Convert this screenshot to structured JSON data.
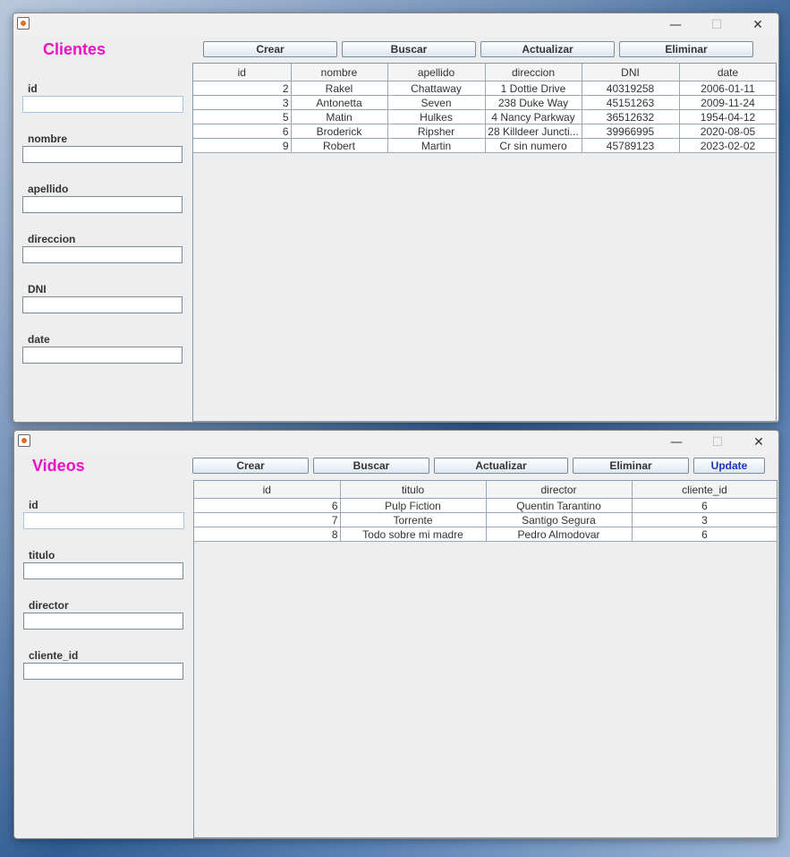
{
  "clientes": {
    "title": "Clientes",
    "window_controls": {
      "minimize": "—",
      "maximize": "☐",
      "close": "✕"
    },
    "buttons": {
      "crear": "Crear",
      "buscar": "Buscar",
      "actualizar": "Actualizar",
      "eliminar": "Eliminar"
    },
    "fields": {
      "id": {
        "label": "id",
        "value": ""
      },
      "nombre": {
        "label": "nombre",
        "value": ""
      },
      "apellido": {
        "label": "apellido",
        "value": ""
      },
      "direccion": {
        "label": "direccion",
        "value": ""
      },
      "dni": {
        "label": "DNI",
        "value": ""
      },
      "date": {
        "label": "date",
        "value": ""
      }
    },
    "table": {
      "columns": [
        "id",
        "nombre",
        "apellido",
        "direccion",
        "DNI",
        "date"
      ],
      "rows": [
        [
          "2",
          "Rakel",
          "Chattaway",
          "1 Dottie Drive",
          "40319258",
          "2006-01-11"
        ],
        [
          "3",
          "Antonetta",
          "Seven",
          "238 Duke Way",
          "45151263",
          "2009-11-24"
        ],
        [
          "5",
          "Matin",
          "Hulkes",
          "4 Nancy Parkway",
          "36512632",
          "1954-04-12"
        ],
        [
          "6",
          "Broderick",
          "Ripsher",
          "28 Killdeer Juncti...",
          "39966995",
          "2020-08-05"
        ],
        [
          "9",
          "Robert",
          "Martin",
          "Cr sin numero",
          "45789123",
          "2023-02-02"
        ]
      ]
    }
  },
  "videos": {
    "title": "Videos",
    "window_controls": {
      "minimize": "—",
      "maximize": "☐",
      "close": "✕"
    },
    "buttons": {
      "crear": "Crear",
      "buscar": "Buscar",
      "actualizar": "Actualizar",
      "eliminar": "Eliminar",
      "update": "Update"
    },
    "fields": {
      "id": {
        "label": "id",
        "value": ""
      },
      "titulo": {
        "label": "titulo",
        "value": ""
      },
      "director": {
        "label": "director",
        "value": ""
      },
      "cliente_id": {
        "label": "cliente_id",
        "value": ""
      }
    },
    "table": {
      "columns": [
        "id",
        "titulo",
        "director",
        "cliente_id"
      ],
      "rows": [
        [
          "6",
          "Pulp Fiction",
          "Quentin Tarantino",
          "6"
        ],
        [
          "7",
          "Torrente",
          "Santigo Segura",
          "3"
        ],
        [
          "8",
          "Todo sobre mi madre",
          "Pedro Almodovar",
          "6"
        ]
      ]
    }
  }
}
